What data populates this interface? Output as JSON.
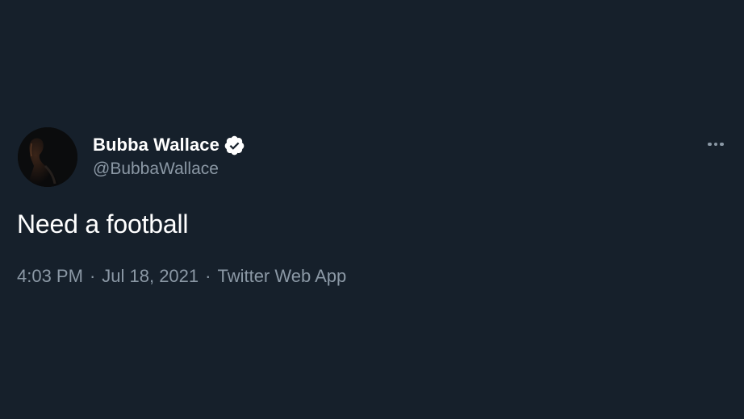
{
  "tweet": {
    "author": {
      "display_name": "Bubba Wallace",
      "handle": "@BubbaWallace",
      "verified": true,
      "avatar_icon": "profile-avatar"
    },
    "text": "Need a football",
    "meta": {
      "time": "4:03 PM",
      "date": "Jul 18, 2021",
      "source": "Twitter Web App",
      "separator": "·"
    },
    "more_icon": "more-horizontal-icon"
  },
  "colors": {
    "background": "#16202b",
    "primary_text": "#ffffff",
    "secondary_text": "#8b98a5",
    "verified_badge": "#ffffff"
  }
}
